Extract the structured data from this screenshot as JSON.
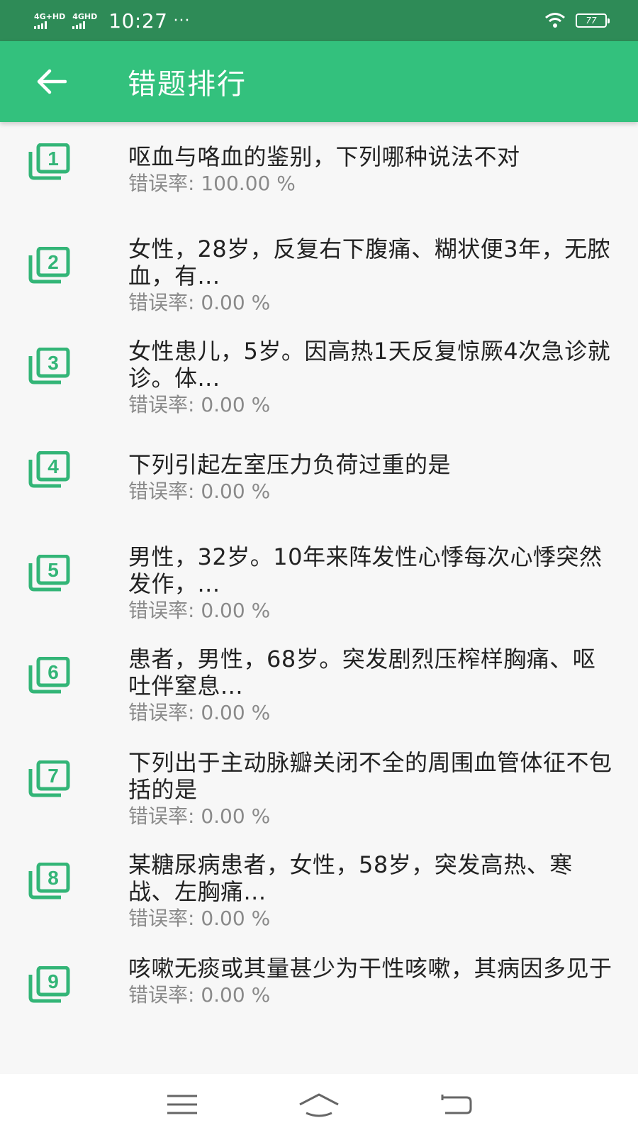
{
  "status_bar": {
    "signal1": "4G+HD",
    "signal2": "4GHD",
    "time": "10:27",
    "more": "···",
    "battery": "77"
  },
  "app_bar": {
    "title": "错题排行"
  },
  "items": [
    {
      "num": "1",
      "question": "呕血与咯血的鉴别，下列哪种说法不对",
      "rate_label": "错误率:",
      "rate": "100.00 %"
    },
    {
      "num": "2",
      "question": "女性，28岁，反复右下腹痛、糊状便3年，无脓血，有...",
      "rate_label": "错误率:",
      "rate": "0.00 %"
    },
    {
      "num": "3",
      "question": "女性患儿，5岁。因高热1天反复惊厥4次急诊就诊。体...",
      "rate_label": "错误率:",
      "rate": "0.00 %"
    },
    {
      "num": "4",
      "question": "下列引起左室压力负荷过重的是",
      "rate_label": "错误率:",
      "rate": "0.00 %"
    },
    {
      "num": "5",
      "question": "男性，32岁。10年来阵发性心悸每次心悸突然发作，...",
      "rate_label": "错误率:",
      "rate": "0.00 %"
    },
    {
      "num": "6",
      "question": "患者，男性，68岁。突发剧烈压榨样胸痛、呕吐伴窒息...",
      "rate_label": "错误率:",
      "rate": "0.00 %"
    },
    {
      "num": "7",
      "question": "下列出于主动脉瓣关闭不全的周围血管体征不包括的是",
      "rate_label": "错误率:",
      "rate": "0.00 %"
    },
    {
      "num": "8",
      "question": "某糖尿病患者，女性，58岁，突发高热、寒战、左胸痛...",
      "rate_label": "错误率:",
      "rate": "0.00 %"
    },
    {
      "num": "9",
      "question": "咳嗽无痰或其量甚少为干性咳嗽，其病因多见于",
      "rate_label": "错误率:",
      "rate": "0.00 %"
    }
  ],
  "icons": {
    "back": "arrow-left-icon",
    "item": "numbered-stack-icon",
    "menu": "menu-icon",
    "home": "home-icon",
    "return": "return-icon",
    "wifi": "wifi-icon"
  },
  "colors": {
    "status_bar": "#2e8b57",
    "app_bar": "#33c17d",
    "icon_green": "#33b577",
    "background": "#f7f7f7"
  }
}
